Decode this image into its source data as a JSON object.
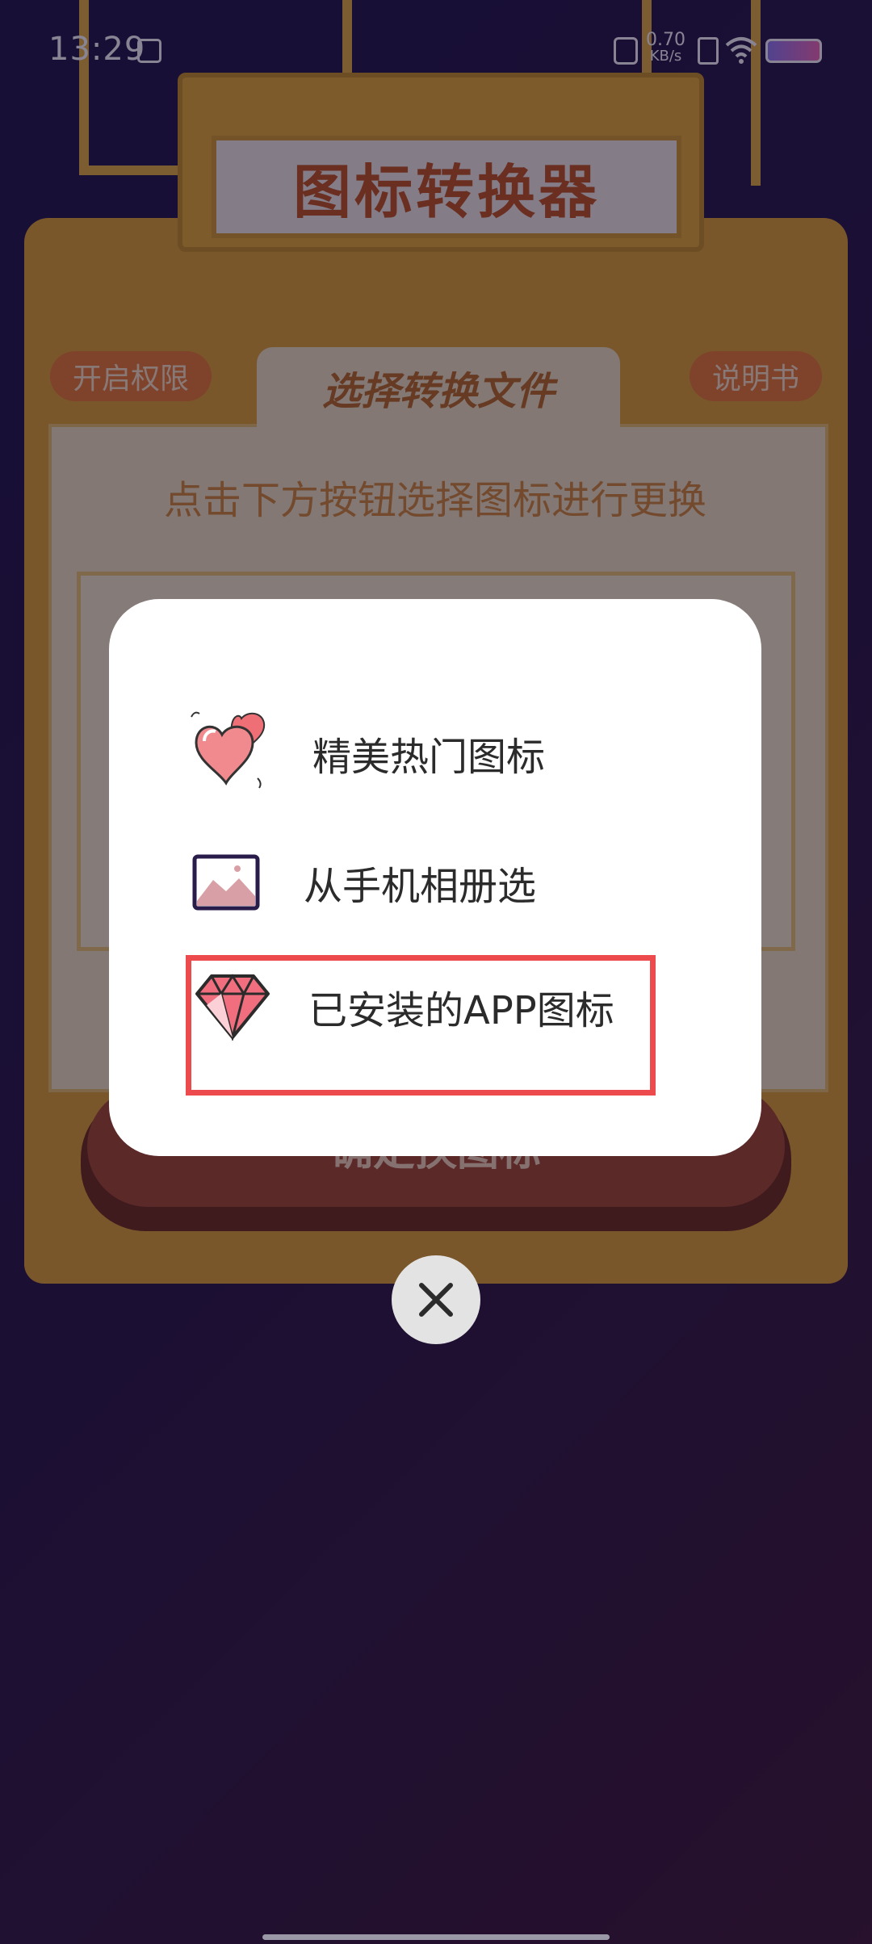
{
  "status_bar": {
    "time": "13:29",
    "net_speed": "0.70",
    "net_unit": "KB/s"
  },
  "background_app": {
    "title": "图标转换器",
    "permission_button": "开启权限",
    "manual_button": "说明书",
    "tab_label": "选择转换文件",
    "hint": "点击下方按钮选择图标进行更换",
    "confirm_button": "确定换图标"
  },
  "dialog": {
    "options": [
      {
        "label": "精美热门图标",
        "icon": "hearts-icon"
      },
      {
        "label": "从手机相册选",
        "icon": "image-icon"
      },
      {
        "label": "已安装的APP图标",
        "icon": "diamond-icon"
      }
    ]
  },
  "colors": {
    "highlight": "#ec4a4d",
    "machine": "#e0a52e",
    "title_text": "#c2551d"
  }
}
